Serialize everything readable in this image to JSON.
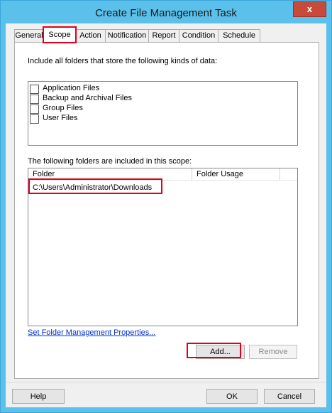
{
  "window": {
    "title": "Create File Management Task",
    "close_glyph": "x"
  },
  "tabs": [
    {
      "label": "General",
      "active": false
    },
    {
      "label": "Scope",
      "active": true
    },
    {
      "label": "Action",
      "active": false
    },
    {
      "label": "Notification",
      "active": false
    },
    {
      "label": "Report",
      "active": false
    },
    {
      "label": "Condition",
      "active": false
    },
    {
      "label": "Schedule",
      "active": false
    }
  ],
  "scope": {
    "include_label": "Include all folders that store the following kinds of data:",
    "data_kinds": [
      {
        "label": "Application Files",
        "checked": false
      },
      {
        "label": "Backup and Archival Files",
        "checked": false
      },
      {
        "label": "Group Files",
        "checked": false
      },
      {
        "label": "User Files",
        "checked": false
      }
    ],
    "folders_label": "The following folders are included in this scope:",
    "columns": {
      "folder": "Folder",
      "usage": "Folder Usage"
    },
    "folders": [
      {
        "path": "C:\\Users\\Administrator\\Downloads",
        "usage": ""
      }
    ],
    "properties_link": "Set Folder Management Properties...",
    "add_label": "Add...",
    "remove_label": "Remove"
  },
  "footer": {
    "help_label": "Help",
    "ok_label": "OK",
    "cancel_label": "Cancel"
  },
  "colors": {
    "frame": "#5bc0ea",
    "highlight": "#e0001b",
    "link": "#0033cc"
  }
}
